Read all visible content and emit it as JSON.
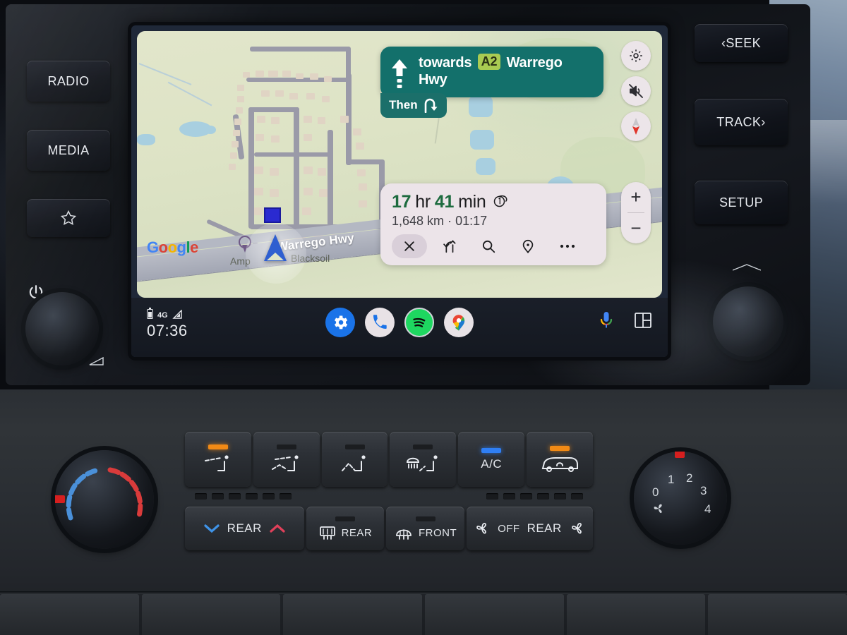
{
  "head_unit": {
    "left_buttons": [
      {
        "name": "radio",
        "label": "RADIO"
      },
      {
        "name": "media",
        "label": "MEDIA"
      },
      {
        "name": "favorites",
        "label": "",
        "icon": "star-icon"
      },
      {
        "name": "power",
        "label": "",
        "icon": "power-icon"
      }
    ],
    "right_buttons": [
      {
        "name": "seek",
        "label": "‹SEEK"
      },
      {
        "name": "track",
        "label": "TRACK›"
      },
      {
        "name": "setup",
        "label": "SETUP"
      }
    ]
  },
  "navigation": {
    "turn_banner": {
      "direction_icon": "straight-arrow-icon",
      "prefix": "towards",
      "shield": "A2",
      "road": "Warrego Hwy"
    },
    "then_banner": {
      "label": "Then",
      "icon": "ramp-right-icon"
    },
    "eta": {
      "hours_value": "17",
      "hours_unit": "hr",
      "minutes_value": "41",
      "minutes_unit": "min",
      "route_badge": "route-1-icon",
      "distance": "1,648 km",
      "separator": "·",
      "arrival_time": "01:17",
      "actions": [
        {
          "name": "close-navigation",
          "icon": "close-icon",
          "selected": true
        },
        {
          "name": "alternate-routes",
          "icon": "alternate-routes-icon",
          "selected": false
        },
        {
          "name": "search-along-route",
          "icon": "search-icon",
          "selected": false
        },
        {
          "name": "recenter-location",
          "icon": "location-pin-icon",
          "selected": false
        },
        {
          "name": "more-options",
          "icon": "more-icon",
          "selected": false
        }
      ]
    },
    "map_controls": [
      {
        "name": "map-settings",
        "icon": "gear-icon"
      },
      {
        "name": "mute-guidance",
        "icon": "volume-muted-icon"
      },
      {
        "name": "compass",
        "icon": "compass-icon"
      }
    ],
    "zoom_controls": [
      {
        "name": "zoom-in",
        "label": "+"
      },
      {
        "name": "zoom-out",
        "label": "−"
      }
    ],
    "map_labels": {
      "poi": "Amp",
      "locality": "Blacksoil",
      "highway": "Warrego Hwy",
      "attribution": "Google"
    }
  },
  "system_bar": {
    "battery_icon": "battery-icon",
    "network_type": "4G",
    "signal_icon": "signal-bars-icon",
    "clock": "07:36",
    "dock_apps": [
      {
        "name": "settings",
        "icon": "gear-icon"
      },
      {
        "name": "phone",
        "icon": "phone-icon"
      },
      {
        "name": "spotify",
        "icon": "spotify-icon"
      },
      {
        "name": "google-maps",
        "icon": "maps-pin-icon"
      }
    ],
    "right_icons": [
      {
        "name": "assistant-microphone",
        "icon": "microphone-icon"
      },
      {
        "name": "split-screen",
        "icon": "split-screen-icon"
      }
    ]
  },
  "climate": {
    "mode_buttons": [
      {
        "name": "vent-face",
        "icon": "face-vent-icon",
        "led": "orange"
      },
      {
        "name": "vent-face-feet",
        "icon": "face-feet-vent-icon",
        "led": "off"
      },
      {
        "name": "vent-feet",
        "icon": "feet-vent-icon",
        "led": "off"
      },
      {
        "name": "vent-defrost-feet",
        "icon": "defrost-feet-vent-icon",
        "led": "off"
      },
      {
        "name": "air-conditioning",
        "label": "A/C",
        "led": "blue"
      },
      {
        "name": "air-recirculation",
        "icon": "recirculate-icon",
        "led": "orange"
      }
    ],
    "lower_buttons": [
      {
        "name": "rear-temperature",
        "label": "REAR",
        "icon_left": "chevron-down-icon",
        "icon_right": "chevron-up-icon"
      },
      {
        "name": "rear-defrost",
        "label": "REAR",
        "icon": "rear-defrost-icon",
        "led": "off"
      },
      {
        "name": "front-defrost",
        "label": "FRONT",
        "icon": "front-defrost-icon",
        "led": "off"
      },
      {
        "name": "rear-fan",
        "label_off": "OFF",
        "label": "REAR",
        "icon_left": "fan-icon",
        "icon_right": "fan-icon"
      }
    ],
    "temperature_knob": {
      "name": "temperature-knob",
      "cold_color": "#4a90d9",
      "hot_color": "#d93b3b"
    },
    "fan_knob": {
      "name": "fan-speed-knob",
      "icon": "fan-icon",
      "marks": [
        "0",
        "1",
        "2",
        "3",
        "4"
      ]
    }
  },
  "colors": {
    "banner_green": "#13706b",
    "shield_green": "#a9cb52",
    "eta_green": "#1d6b3f",
    "card_bg": "#ece4e9",
    "map_bg": "#dfe4c8",
    "led_orange": "#f28a15",
    "led_blue": "#2f7ff5"
  }
}
